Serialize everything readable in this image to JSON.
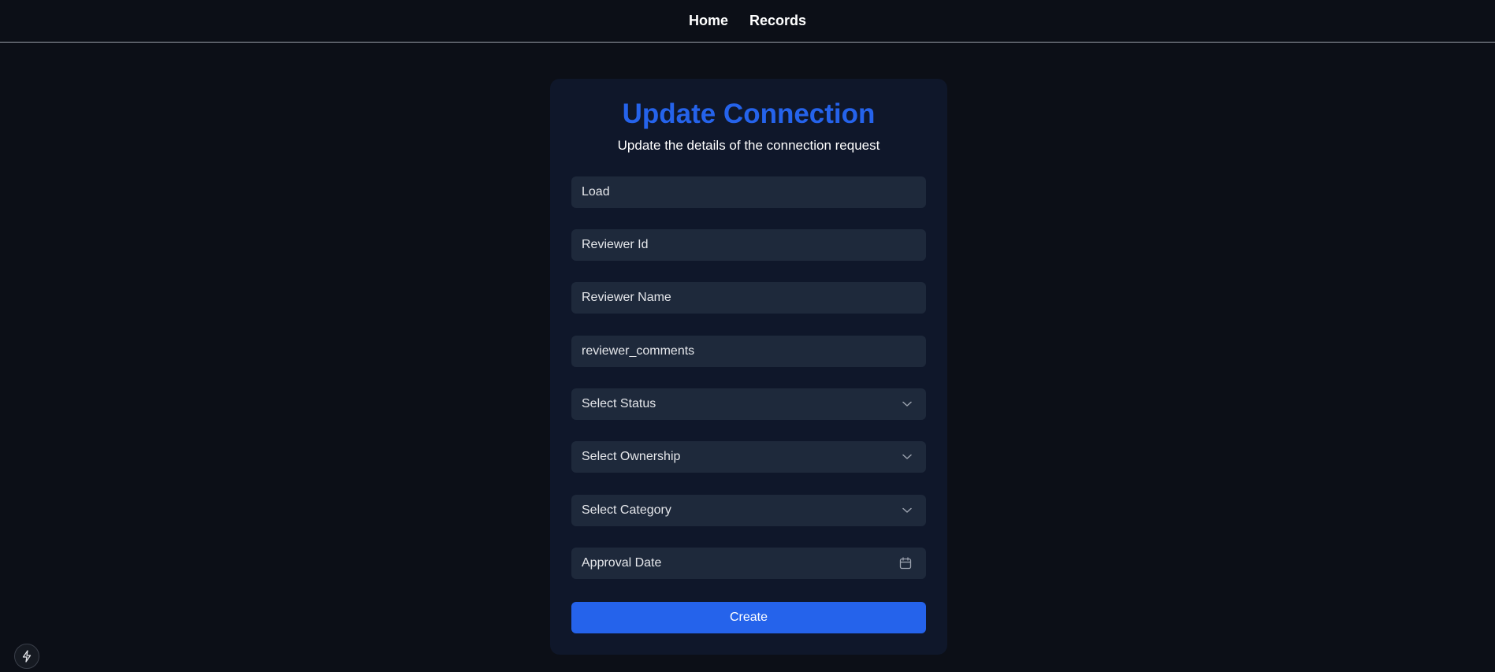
{
  "nav": {
    "links": [
      "Home",
      "Records"
    ]
  },
  "form": {
    "title": "Update Connection",
    "subtitle": "Update the details of the connection request",
    "fields": [
      {
        "placeholder": "Load",
        "type": "text"
      },
      {
        "placeholder": "Reviewer Id",
        "type": "text"
      },
      {
        "placeholder": "Reviewer Name",
        "type": "text"
      },
      {
        "placeholder": "reviewer_comments",
        "type": "text"
      },
      {
        "placeholder": "Select Status",
        "type": "select",
        "icon": "chevron-down-icon"
      },
      {
        "placeholder": "Select Ownership",
        "type": "select",
        "icon": "chevron-down-icon"
      },
      {
        "placeholder": "Select Category",
        "type": "select",
        "icon": "chevron-down-icon"
      },
      {
        "placeholder": "Approval Date",
        "type": "date",
        "icon": "calendar-icon"
      }
    ],
    "submit_label": "Create"
  },
  "colors": {
    "background": "#0c0f17",
    "card": "#0f172a",
    "field": "#1e293b",
    "accent": "#2563eb"
  },
  "fab": {
    "icon": "lightning-icon"
  }
}
